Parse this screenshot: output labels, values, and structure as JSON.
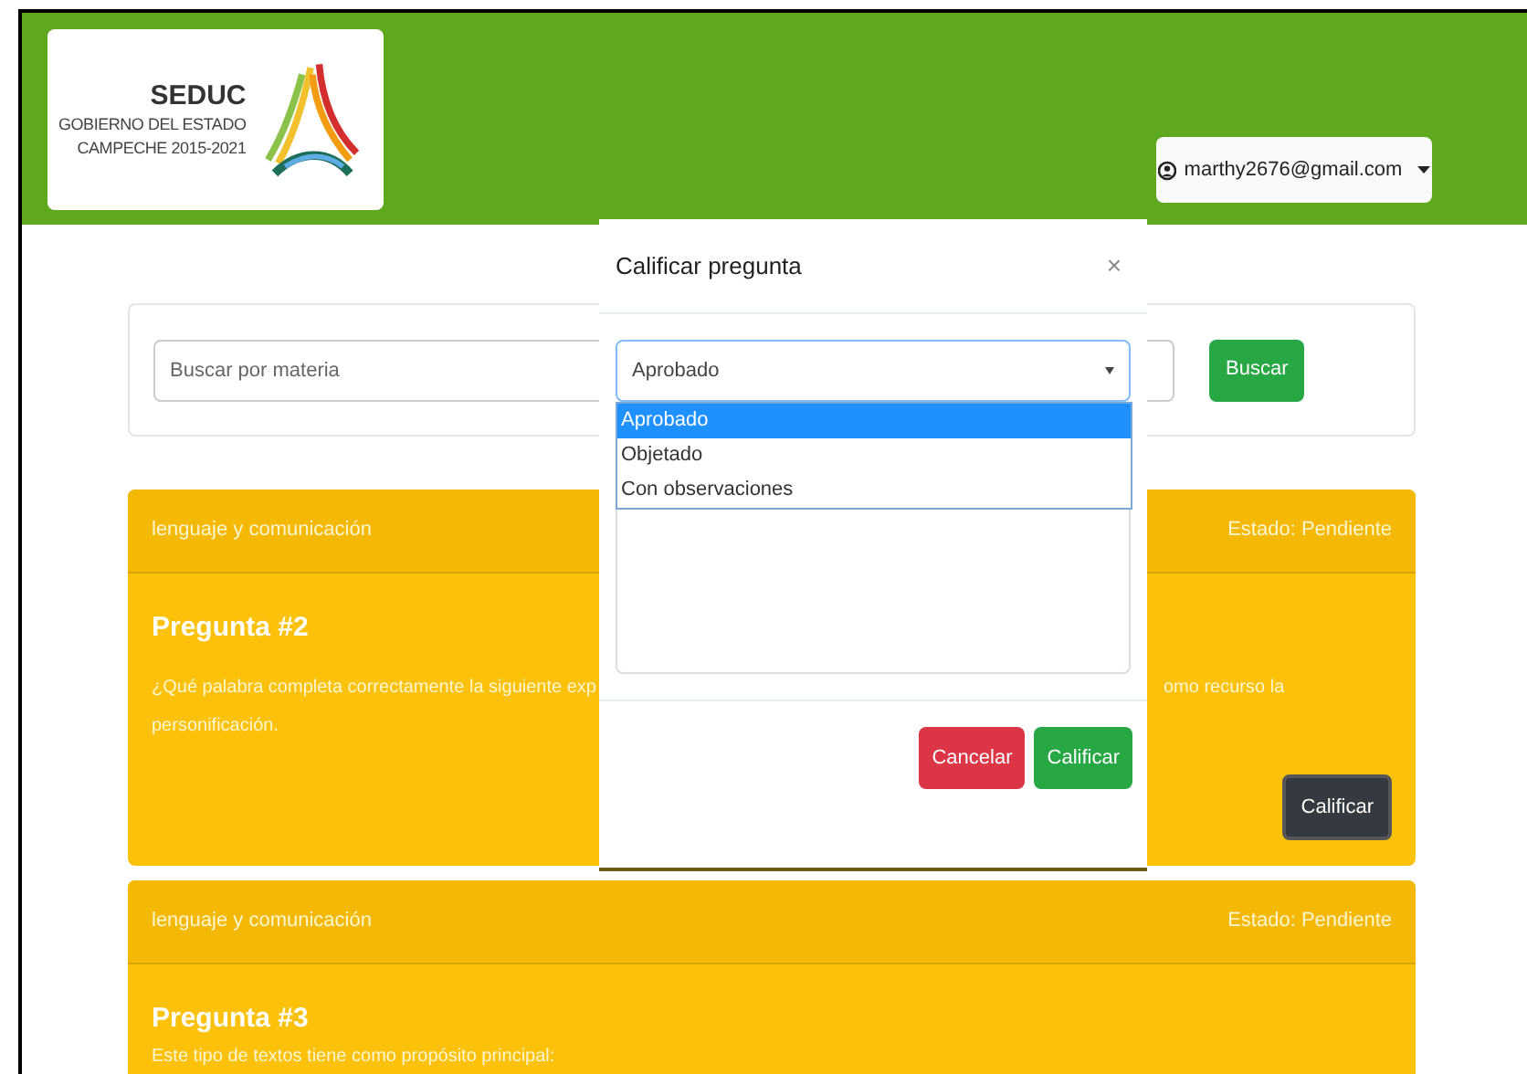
{
  "header": {
    "logo": {
      "title": "SEDUC",
      "subtitle_lines": [
        "GOBIERNO DEL ESTADO",
        "CAMPECHE 2015-2021"
      ]
    },
    "user_menu": {
      "label": "marthy2676@gmail.com"
    }
  },
  "search": {
    "placeholder": "Buscar por materia",
    "button": "Buscar"
  },
  "cards": [
    {
      "subject": "lenguaje y comunicación",
      "status": "Estado: Pendiente",
      "title": "Pregunta #2",
      "text_left": "¿Qué palabra completa correctamente la siguiente exp",
      "text_right": "omo recurso la",
      "text_line_2": "personificación.",
      "button": "Calificar"
    },
    {
      "subject": "lenguaje y comunicación",
      "status": "Estado: Pendiente",
      "title": "Pregunta #3",
      "text_left": "Este tipo de textos tiene como propósito principal:"
    }
  ],
  "modal": {
    "title": "Calificar pregunta",
    "close": "×",
    "select_value": "Aprobado",
    "options": [
      {
        "label": "Aprobado",
        "selected": true
      },
      {
        "label": "Objetado",
        "selected": false
      },
      {
        "label": "Con observaciones",
        "selected": false
      }
    ],
    "buttons": [
      {
        "label": "Cancelar",
        "kind": "danger"
      },
      {
        "label": "Calificar",
        "kind": "success"
      }
    ]
  }
}
